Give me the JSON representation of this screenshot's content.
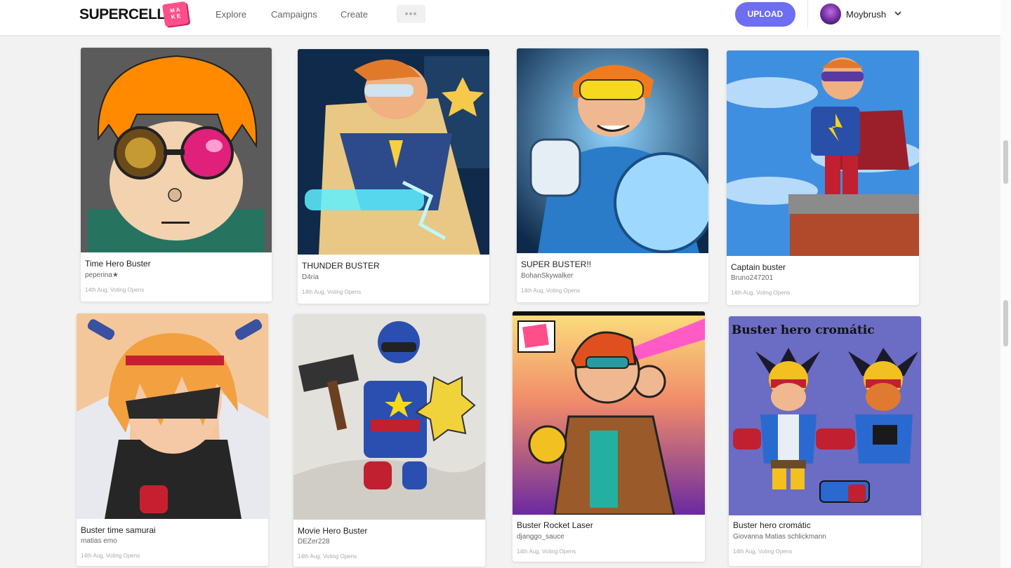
{
  "header": {
    "logo": "SUPERCELL",
    "logo_badge": "MAKE",
    "nav": [
      "Explore",
      "Campaigns",
      "Create"
    ],
    "more_label": "•••",
    "upload_label": "UPLOAD",
    "user": {
      "name": "Moybrush"
    }
  },
  "cards": [
    {
      "title": "Time Hero Buster",
      "author": "peperina★",
      "meta": "14th Aug, Voting Opens"
    },
    {
      "title": "THUNDER BUSTER",
      "author": "D4ria",
      "meta": "14th Aug, Voting Opens"
    },
    {
      "title": "SUPER BUSTER!!",
      "author": "BohanSkywalker",
      "meta": "14th Aug, Voting Opens"
    },
    {
      "title": "Captain buster",
      "author": "Bruno247201",
      "meta": "14th Aug, Voting Opens"
    },
    {
      "title": "Buster time samurai",
      "author": "matias emo",
      "meta": "14th Aug, Voting Opens"
    },
    {
      "title": "Movie Hero Buster",
      "author": "DEZer228",
      "meta": "14th Aug, Voting Opens"
    },
    {
      "title": "Buster Rocket Laser",
      "author": "djanggo_sauce",
      "meta": "14th Aug, Voting Opens"
    },
    {
      "title": "Buster hero cromátic",
      "author": "Giovanna Matias schlickmann",
      "meta": "14th Aug, Voting Opens"
    }
  ],
  "artwork_text": {
    "cromatic_caption": "Buster hero cromátic"
  },
  "colors": {
    "accent": "#6d6ef2",
    "brand_badge": "#ff4f8b"
  }
}
